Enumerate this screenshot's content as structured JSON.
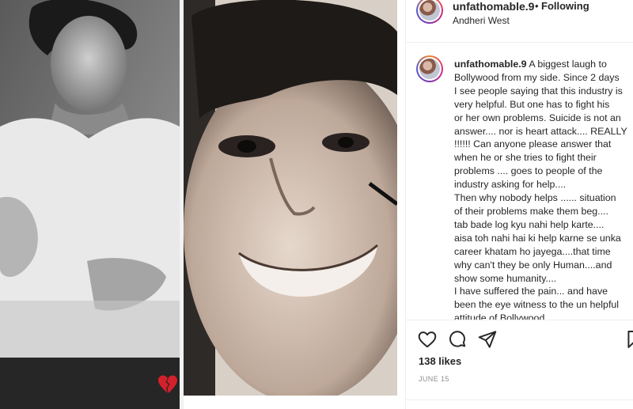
{
  "post": {
    "username": "unfathomable.9",
    "separator": "•",
    "follow_status": "Following",
    "location": "Andheri West",
    "caption_lines": [
      "A biggest laugh to",
      "Bollywood from my side. Since 2 days",
      "I see people saying that this industry is",
      "very helpful. But one has to fight his",
      "or her own problems. Suicide is not an",
      "answer.... nor is heart attack.... REALLY",
      "!!!!!! Can anyone please answer that",
      "when he or she tries to fight their",
      "problems .... goes to people of the",
      "industry asking for help....",
      "Then why nobody helps ...... situation",
      "of their problems make them beg....",
      "tab bade log kyu nahi help karte....",
      "aisa toh nahi hai ki help karne se unka",
      "career khatam ho jayega....that time",
      "why can't they be only Human....and",
      "show some humanity....",
      "I have suffered the pain... and have",
      "been the eye witness to the un helpful",
      "attitude of Bollywood"
    ],
    "likes": "138 likes",
    "date": "JUNE 15",
    "emoji": "broken-heart"
  },
  "icons": {
    "like": "heart-icon",
    "comment": "comment-icon",
    "share": "share-icon",
    "save": "bookmark-icon"
  },
  "colors": {
    "text": "#262626",
    "muted": "#8e8e8e",
    "border": "#efefef",
    "heart_emoji": "#d4202b"
  }
}
